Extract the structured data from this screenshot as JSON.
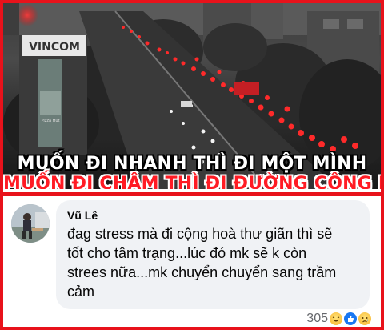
{
  "photo": {
    "sign_vincom": "VINCOM",
    "sign_pizza": "Pizza Hut"
  },
  "captions": {
    "line1": "MUỐN ĐI NHANH THÌ ĐI MỘT MÌNH",
    "line2": "MUỐN ĐI CHẬM THÌ ĐI ĐƯỜNG CỘNG HÒA",
    "line1_color": "#ffffff",
    "line2_color": "#ff1b24"
  },
  "comment": {
    "author": "Vũ Lê",
    "lines": [
      "đag stress mà đi cộng hoà thư giãn thì sẽ",
      "tốt cho tâm trạng...lúc đó mk sẽ k còn",
      "strees nữa...mk chuyển chuyển sang trầm",
      "cảm"
    ],
    "reaction_count": "305",
    "reaction_icons": [
      "haha-icon",
      "like-icon",
      "sad-icon"
    ]
  },
  "frame_color": "#e8121b"
}
